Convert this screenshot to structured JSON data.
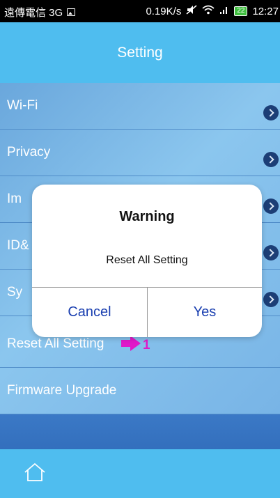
{
  "status_bar": {
    "carrier": "遠傳電信 3G",
    "speed": "0.19K/s",
    "battery": "22",
    "time": "12:27"
  },
  "header": {
    "title": "Setting"
  },
  "menu": {
    "items": [
      {
        "label": "Wi-Fi"
      },
      {
        "label": "Privacy"
      },
      {
        "label": "Im"
      },
      {
        "label": "ID&"
      },
      {
        "label": "Sy"
      },
      {
        "label": "Reset All Setting"
      },
      {
        "label": "Firmware Upgrade"
      }
    ]
  },
  "annotation": {
    "number": "1"
  },
  "dialog": {
    "title": "Warning",
    "message": "Reset All Setting",
    "cancel_label": "Cancel",
    "yes_label": "Yes"
  },
  "colors": {
    "header": "#4fbdef",
    "dialog_button_text": "#1a3fb0",
    "annotation": "#e019c9"
  }
}
